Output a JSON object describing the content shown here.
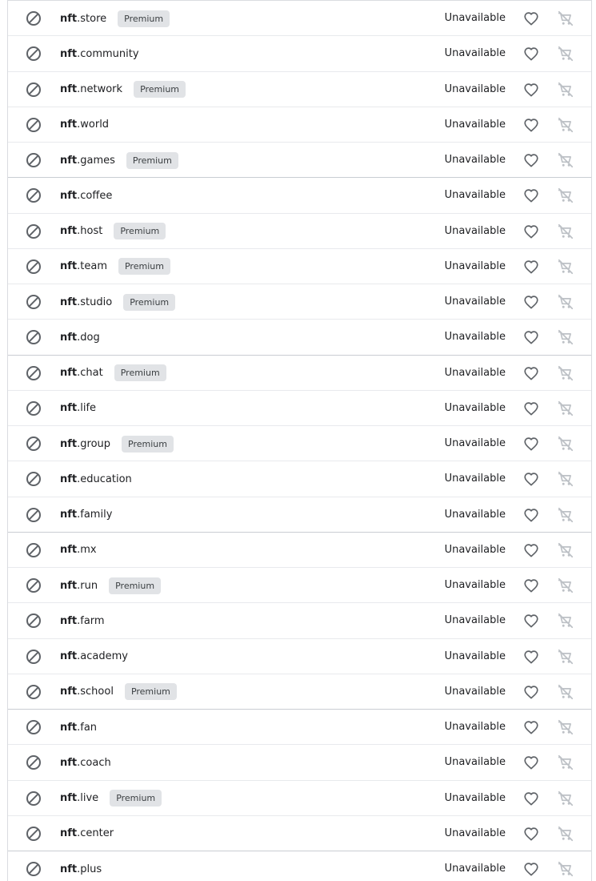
{
  "rows": [
    {
      "sld": "nft",
      "tld": ".store",
      "premium": true,
      "status": "Unavailable"
    },
    {
      "sld": "nft",
      "tld": ".community",
      "premium": false,
      "status": "Unavailable"
    },
    {
      "sld": "nft",
      "tld": ".network",
      "premium": true,
      "status": "Unavailable"
    },
    {
      "sld": "nft",
      "tld": ".world",
      "premium": false,
      "status": "Unavailable"
    },
    {
      "sld": "nft",
      "tld": ".games",
      "premium": true,
      "status": "Unavailable"
    },
    {
      "sld": "nft",
      "tld": ".coffee",
      "premium": false,
      "status": "Unavailable"
    },
    {
      "sld": "nft",
      "tld": ".host",
      "premium": true,
      "status": "Unavailable"
    },
    {
      "sld": "nft",
      "tld": ".team",
      "premium": true,
      "status": "Unavailable"
    },
    {
      "sld": "nft",
      "tld": ".studio",
      "premium": true,
      "status": "Unavailable"
    },
    {
      "sld": "nft",
      "tld": ".dog",
      "premium": false,
      "status": "Unavailable"
    },
    {
      "sld": "nft",
      "tld": ".chat",
      "premium": true,
      "status": "Unavailable"
    },
    {
      "sld": "nft",
      "tld": ".life",
      "premium": false,
      "status": "Unavailable"
    },
    {
      "sld": "nft",
      "tld": ".group",
      "premium": true,
      "status": "Unavailable"
    },
    {
      "sld": "nft",
      "tld": ".education",
      "premium": false,
      "status": "Unavailable"
    },
    {
      "sld": "nft",
      "tld": ".family",
      "premium": false,
      "status": "Unavailable"
    },
    {
      "sld": "nft",
      "tld": ".mx",
      "premium": false,
      "status": "Unavailable"
    },
    {
      "sld": "nft",
      "tld": ".run",
      "premium": true,
      "status": "Unavailable"
    },
    {
      "sld": "nft",
      "tld": ".farm",
      "premium": false,
      "status": "Unavailable"
    },
    {
      "sld": "nft",
      "tld": ".academy",
      "premium": false,
      "status": "Unavailable"
    },
    {
      "sld": "nft",
      "tld": ".school",
      "premium": true,
      "status": "Unavailable"
    },
    {
      "sld": "nft",
      "tld": ".fan",
      "premium": false,
      "status": "Unavailable"
    },
    {
      "sld": "nft",
      "tld": ".coach",
      "premium": false,
      "status": "Unavailable"
    },
    {
      "sld": "nft",
      "tld": ".live",
      "premium": true,
      "status": "Unavailable"
    },
    {
      "sld": "nft",
      "tld": ".center",
      "premium": false,
      "status": "Unavailable"
    },
    {
      "sld": "nft",
      "tld": ".plus",
      "premium": false,
      "status": "Unavailable"
    }
  ],
  "badge_label": "Premium",
  "icons": {
    "status": "block-icon",
    "favorite": "heart-outline-icon",
    "cart": "remove-shopping-cart-icon"
  },
  "colors": {
    "icon_dark": "#5f6368",
    "icon_disabled": "#bdc1c6",
    "badge_bg": "#e1e3e6",
    "divider": "#e8eaed"
  }
}
